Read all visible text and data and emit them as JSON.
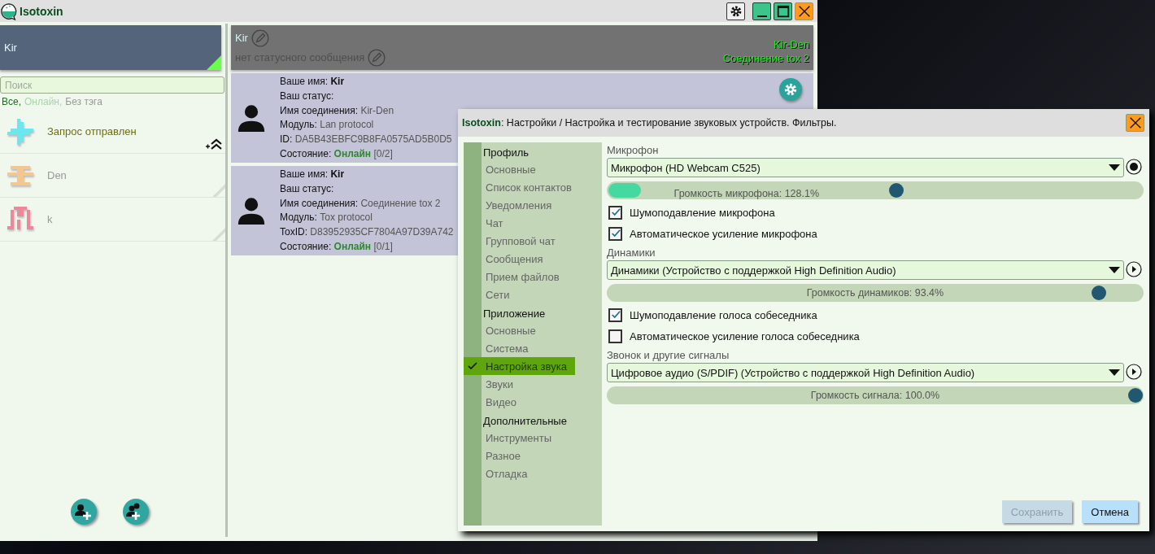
{
  "window": {
    "title": "Isotoxin"
  },
  "profile": {
    "name": "Kir",
    "online": true
  },
  "search": {
    "placeholder": "Поиск"
  },
  "filters": [
    {
      "label": "Все,",
      "selected": true
    },
    {
      "label": "Онлайн,",
      "selected": false
    },
    {
      "label": "Без тэга",
      "selected": false
    }
  ],
  "contacts": [
    {
      "name": "Запрос отправлен",
      "kind": "request",
      "color": "#6ee6ee"
    },
    {
      "name": "Den",
      "kind": "offline",
      "color": "#f2c890"
    },
    {
      "name": "k",
      "kind": "offline",
      "color": "#e88a9a"
    }
  ],
  "header": {
    "name": "Kir",
    "status_placeholder": "нет статусного сообщения",
    "connections": [
      "Kir-Den",
      "Соединение tox 2"
    ]
  },
  "connections": [
    {
      "lines": [
        {
          "label": "Ваше имя:",
          "value": "Kir",
          "kind": "bold"
        },
        {
          "label": "Ваш статус:",
          "kind": "plain"
        },
        {
          "label": "Имя соединения:",
          "value": "Kir-Den",
          "kind": "plain"
        },
        {
          "label": "Модуль:",
          "value": "Lan protocol",
          "kind": "plain"
        },
        {
          "label": "ID:",
          "value": "DA5B43EBFC9B8FA0575AD5B0D5",
          "kind": "plain"
        },
        {
          "label": "Состояние:",
          "value": "Онлайн",
          "extra": "[0/2]",
          "kind": "state"
        }
      ],
      "settings": true
    },
    {
      "lines": [
        {
          "label": "Ваше имя:",
          "value": "Kir",
          "kind": "bold"
        },
        {
          "label": "Ваш статус:",
          "kind": "plain"
        },
        {
          "label": "Имя соединения:",
          "value": "Соединение tox 2",
          "kind": "plain"
        },
        {
          "label": "Модуль:",
          "value": "Tox protocol",
          "kind": "plain"
        },
        {
          "label": "ToxID:",
          "value": "D83952935CF7804A97D39A742",
          "kind": "plain"
        },
        {
          "label": "Состояние:",
          "value": "Онлайн",
          "extra": "[0/1]",
          "kind": "state"
        }
      ]
    }
  ],
  "dialog": {
    "app": "Isotoxin",
    "title": ": Настройки / Настройка и тестирование звуковых устройств. Фильтры.",
    "nav": [
      {
        "label": "Профиль",
        "children": [
          {
            "label": "Основные",
            "selected": false
          },
          {
            "label": "Список контактов",
            "selected": false
          },
          {
            "label": "Уведомления",
            "selected": false
          },
          {
            "label": "Чат",
            "selected": false
          },
          {
            "label": "Групповой чат",
            "selected": false
          },
          {
            "label": "Сообщения",
            "selected": false
          },
          {
            "label": "Прием файлов",
            "selected": false
          },
          {
            "label": "Сети",
            "selected": false
          }
        ]
      },
      {
        "label": "Приложение",
        "children": [
          {
            "label": "Основные",
            "selected": false
          },
          {
            "label": "Система",
            "selected": false
          },
          {
            "label": "Настройка звука",
            "selected": true
          },
          {
            "label": "Звуки",
            "selected": false
          },
          {
            "label": "Видео",
            "selected": false
          }
        ]
      },
      {
        "label": "Дополнительные",
        "children": [
          {
            "label": "Инструменты",
            "selected": false
          },
          {
            "label": "Разное",
            "selected": false
          },
          {
            "label": "Отладка",
            "selected": false
          }
        ]
      }
    ],
    "sections": [
      {
        "label": "Микрофон",
        "device": "Микрофон (HD Webcam C525)",
        "kind": "record",
        "slider": {
          "label": "Громкость микрофона: 128.1%",
          "level": 0.54,
          "meter": {
            "level": 0.06
          }
        },
        "options": [
          {
            "label": "Шумоподавление микрофона",
            "checked": true
          },
          {
            "label": "Автоматическое усиление микрофона",
            "checked": true
          }
        ]
      },
      {
        "label": "Динамики",
        "device": "Динамики (Устройство с поддержкой High Definition Audio)",
        "kind": "play",
        "slider": {
          "label": "Громкость динамиков: 93.4%",
          "level": 0.93
        },
        "options": [
          {
            "label": "Шумоподавление голоса собеседника",
            "checked": true
          },
          {
            "label": "Автоматическое усиление голоса собеседника",
            "checked": false
          }
        ]
      },
      {
        "label": "Звонок и другие сигналы",
        "device": "Цифровое аудио (S/PDIF) (Устройство с поддержкой High Definition Audio)",
        "kind": "play",
        "slider": {
          "label": "Громкость сигнала: 100.0%",
          "level": 1.0
        }
      }
    ],
    "buttons": [
      {
        "label": "Сохранить",
        "disabled": true
      },
      {
        "label": "Отмена",
        "disabled": false
      }
    ]
  }
}
